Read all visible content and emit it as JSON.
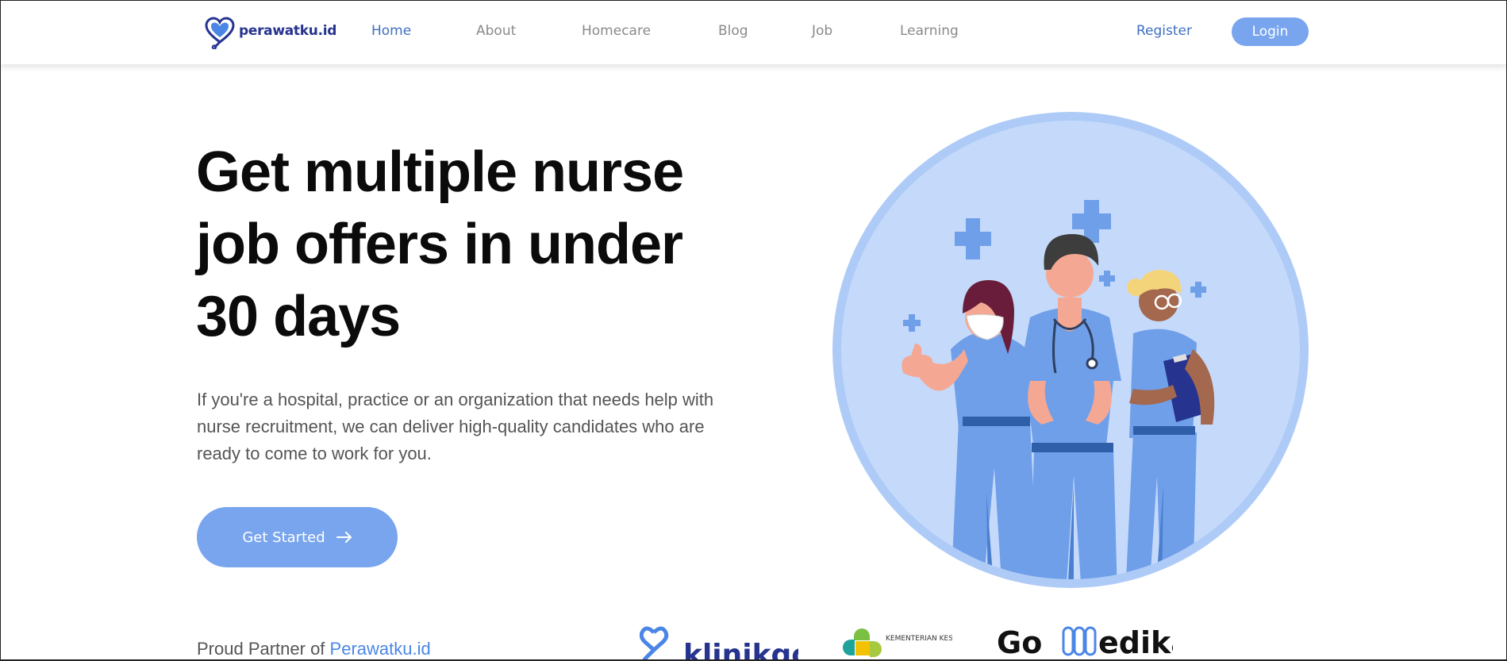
{
  "brand": {
    "name": "perawatku.id",
    "color": "#26348f"
  },
  "nav": {
    "links": [
      {
        "label": "Home",
        "active": true
      },
      {
        "label": "About",
        "active": false
      },
      {
        "label": "Homecare",
        "active": false
      },
      {
        "label": "Blog",
        "active": false
      },
      {
        "label": "Job",
        "active": false
      },
      {
        "label": "Learning",
        "active": false
      }
    ],
    "register_label": "Register",
    "login_label": "Login"
  },
  "hero": {
    "title": "Get multiple nurse job offers in under 30 days",
    "description": "If you're a hospital, practice or an organization that needs help with nurse recruitment, we can deliver high-quality candidates who are ready to come to work for you.",
    "cta_label": "Get Started",
    "cta_icon": "arrow-right-icon",
    "illustration": "three-nurses-illustration"
  },
  "partners": {
    "prefix": "Proud Partner of ",
    "link_label": "Perawatku.id",
    "logos": [
      {
        "name": "klinikgo",
        "text": "klinikgo"
      },
      {
        "name": "kemenkes",
        "text": "KEMENTERIAN KESEHATAN REPUBLIK"
      },
      {
        "name": "gomedika",
        "text_a": "Go",
        "text_b": "edika"
      }
    ]
  },
  "colors": {
    "accent": "#78a5ee",
    "link_active": "#3f6fc2",
    "nav_inactive": "#8a8a8a",
    "circle": "#c5dafa",
    "scrubs": "#6f9fe9"
  }
}
